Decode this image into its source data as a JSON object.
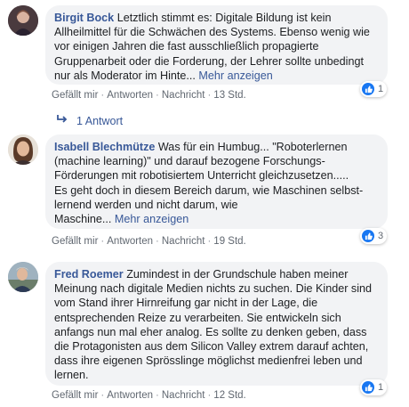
{
  "comments": [
    {
      "author": "Birgit Bock",
      "text": "Letztlich stimmt es: Digitale Bildung ist kein Allheilmittel für die Schwächen des Systems. Ebenso wenig wie vor einigen Jahren die fast ausschließlich propagierte Gruppenarbeit oder die Forderung, der Lehrer sollte unbedingt nur als Moderator im Hinte...",
      "more": "Mehr anzeigen",
      "like": "Gefällt mir",
      "reply": "Antworten",
      "message": "Nachricht",
      "time": "13 Std.",
      "reactions": "1",
      "replies_label": "1 Antwort"
    },
    {
      "author": "Isabell Blechmütze",
      "text_lines": [
        "Was für ein Humbug... \"Roboterlernen",
        "(machine learning)\" und darauf bezogene Forschungs-",
        "Förderungen mit robotisiertem Unterricht gleichzusetzen.....",
        "Es geht doch in diesem Bereich darum, wie Maschinen selbst-",
        "lernend werden und nicht darum, wie",
        "Maschine..."
      ],
      "more": "Mehr anzeigen",
      "like": "Gefällt mir",
      "reply": "Antworten",
      "message": "Nachricht",
      "time": "19 Std.",
      "reactions": "3"
    },
    {
      "author": "Fred Roemer",
      "text": "Zumindest in der Grundschule haben meiner Meinung nach digitale Medien nichts zu suchen. Die Kinder sind vom Stand ihrer Hirnreifung gar nicht in der Lage, die entsprechenden Reize zu verarbeiten. Sie entwickeln sich anfangs nun mal eher analog. Es sollte zu denken geben, dass die Protagonisten aus dem Silicon Valley extrem darauf achten, dass ihre eigenen Sprösslinge möglichst medienfrei leben und lernen.",
      "like": "Gefällt mir",
      "reply": "Antworten",
      "message": "Nachricht",
      "time": "12 Std.",
      "reactions": "1"
    }
  ],
  "colors": {
    "link": "#385898",
    "bubble": "#f2f3f5",
    "like": "#1877f2",
    "meta": "#606770"
  },
  "icons": [
    "thumbs-up-icon",
    "reply-arrow-icon"
  ]
}
